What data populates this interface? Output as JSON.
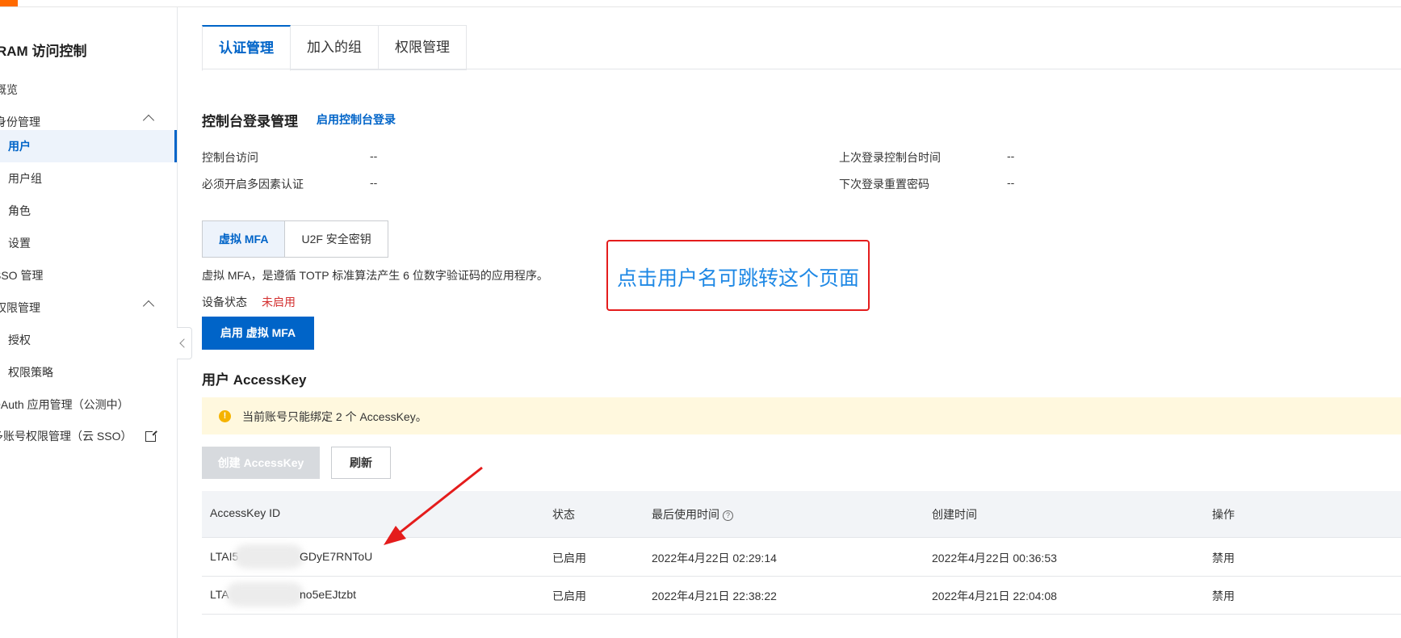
{
  "sidebar": {
    "title": "RAM 访问控制",
    "items": [
      {
        "label": "概览"
      },
      {
        "label": "身份管理"
      },
      {
        "label": "用户"
      },
      {
        "label": "用户组"
      },
      {
        "label": "角色"
      },
      {
        "label": "设置"
      },
      {
        "label": "SSO 管理"
      },
      {
        "label": "权限管理"
      },
      {
        "label": "授权"
      },
      {
        "label": "权限策略"
      },
      {
        "label": "OAuth 应用管理（公测中）"
      },
      {
        "label": "多账号权限管理（云 SSO）"
      }
    ]
  },
  "tabs": [
    "认证管理",
    "加入的组",
    "权限管理"
  ],
  "console_login": {
    "title": "控制台登录管理",
    "action": "启用控制台登录",
    "fields": [
      {
        "key": "控制台访问",
        "value": "--"
      },
      {
        "key": "必须开启多因素认证",
        "value": "--"
      },
      {
        "key": "上次登录控制台时间",
        "value": "--"
      },
      {
        "key": "下次登录重置密码",
        "value": "--"
      }
    ]
  },
  "mfa": {
    "tabs": [
      "虚拟 MFA",
      "U2F 安全密钥"
    ],
    "description": "虚拟 MFA，是遵循 TOTP 标准算法产生 6 位数字验证码的应用程序。",
    "status_label": "设备状态",
    "status_value": "未启用",
    "enable_button": "启用 虚拟 MFA"
  },
  "accesskey": {
    "title": "用户 AccessKey",
    "notice": "当前账号只能绑定 2 个 AccessKey。",
    "create_button": "创建 AccessKey",
    "refresh_button": "刷新",
    "columns": [
      "AccessKey ID",
      "状态",
      "最后使用时间",
      "创建时间",
      "操作"
    ],
    "rows": [
      {
        "id_prefix": "LTAI5",
        "id_suffix": "GDyE7RNToU",
        "status": "已启用",
        "last_used": "2022年4月22日 02:29:14",
        "created": "2022年4月22日 00:36:53",
        "action": "禁用"
      },
      {
        "id_prefix": "LTA",
        "id_suffix": "no5eEJtzbt",
        "status": "已启用",
        "last_used": "2022年4月21日 22:38:22",
        "created": "2022年4月21日 22:04:08",
        "action": "禁用"
      }
    ]
  },
  "annotation": {
    "text": "点击用户名可跳转这个页面",
    "color": "#e41c1c"
  },
  "colors": {
    "primary": "#0064c8",
    "brand": "#ff6a00",
    "danger_text": "#d32f2f"
  }
}
